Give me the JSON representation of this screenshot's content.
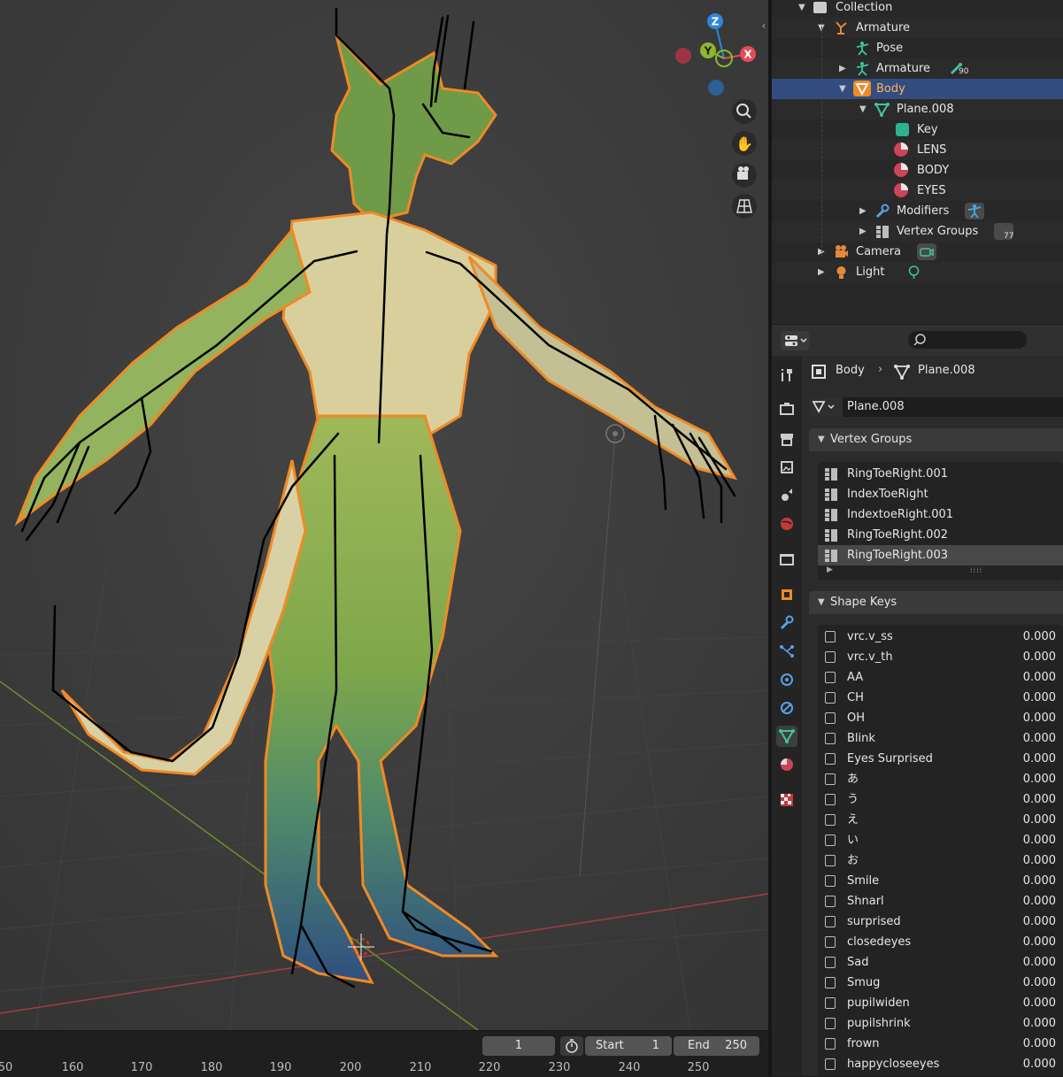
{
  "timeline": {
    "current_frame": "1",
    "start_label": "Start",
    "start_value": "1",
    "end_label": "End",
    "end_value": "250",
    "ticks": [
      "50",
      "160",
      "170",
      "180",
      "190",
      "200",
      "210",
      "220",
      "230",
      "240",
      "250"
    ]
  },
  "outliner": {
    "rows": [
      {
        "label": "Collection"
      },
      {
        "label": "Armature"
      },
      {
        "label": "Pose"
      },
      {
        "label": "Armature",
        "badge": "90"
      },
      {
        "label": "Body"
      },
      {
        "label": "Plane.008"
      },
      {
        "label": "Key"
      },
      {
        "label": "LENS"
      },
      {
        "label": "BODY"
      },
      {
        "label": "EYES"
      },
      {
        "label": "Modifiers"
      },
      {
        "label": "Vertex Groups",
        "badge": "77"
      },
      {
        "label": "Camera"
      },
      {
        "label": "Light"
      }
    ]
  },
  "properties": {
    "breadcrumb_object": "Body",
    "breadcrumb_data": "Plane.008",
    "mesh_name": "Plane.008",
    "vertex_groups_title": "Vertex Groups",
    "vertex_groups": [
      "RingToeRight.001",
      "IndexToeRight",
      "IndextoeRight.001",
      "RingToeRight.002",
      "RingToeRight.003"
    ],
    "shape_keys_title": "Shape Keys",
    "shape_keys": [
      {
        "name": "vrc.v_ss",
        "value": "0.000"
      },
      {
        "name": "vrc.v_th",
        "value": "0.000"
      },
      {
        "name": "AA",
        "value": "0.000"
      },
      {
        "name": "CH",
        "value": "0.000"
      },
      {
        "name": "OH",
        "value": "0.000"
      },
      {
        "name": "Blink",
        "value": "0.000"
      },
      {
        "name": "Eyes Surprised",
        "value": "0.000"
      },
      {
        "name": "あ",
        "value": "0.000"
      },
      {
        "name": "う",
        "value": "0.000"
      },
      {
        "name": "え",
        "value": "0.000"
      },
      {
        "name": "い",
        "value": "0.000"
      },
      {
        "name": "お",
        "value": "0.000"
      },
      {
        "name": "Smile",
        "value": "0.000"
      },
      {
        "name": "Shnarl",
        "value": "0.000"
      },
      {
        "name": "surprised",
        "value": "0.000"
      },
      {
        "name": "closedeyes",
        "value": "0.000"
      },
      {
        "name": "Sad",
        "value": "0.000"
      },
      {
        "name": "Smug",
        "value": "0.000"
      },
      {
        "name": "pupilwiden",
        "value": "0.000"
      },
      {
        "name": "pupilshrink",
        "value": "0.000"
      },
      {
        "name": "frown",
        "value": "0.000"
      },
      {
        "name": "happycloseeyes",
        "value": "0.000"
      }
    ]
  },
  "gizmo": {
    "z": "Z",
    "y": "Y",
    "x": "X"
  },
  "colors": {
    "accent_selected": "#334d80",
    "outline_orange": "#f08a24",
    "x_axis": "#e34a5a",
    "y_axis": "#8ab82f",
    "z_axis": "#2f86d8",
    "viewport_bg": "#3d3d3d"
  }
}
